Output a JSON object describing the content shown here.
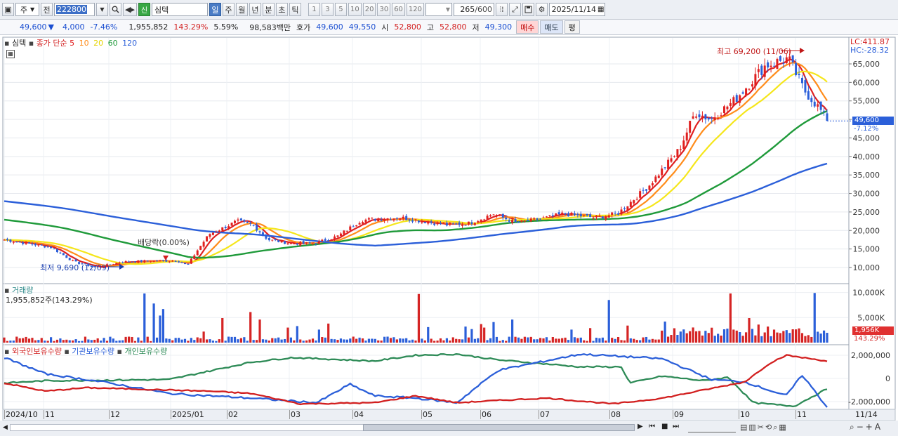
{
  "toolbar": {
    "period_label": "주",
    "prev_label": "전",
    "stock_code": "222800",
    "badge": "신",
    "stock_name": "심텍",
    "tabs": [
      "일",
      "주",
      "월",
      "년",
      "분",
      "초",
      "틱"
    ],
    "active_tab": "일",
    "intervals": [
      "1",
      "3",
      "5",
      "10",
      "20",
      "30",
      "60",
      "120"
    ],
    "count_value": "265",
    "count_max": "/600",
    "date_value": "2025/11/14"
  },
  "quote": {
    "price": "49,600",
    "direction": "▼",
    "change": "4,000",
    "change_rate": "-7.46%",
    "volume": "1,955,852",
    "volume_rate": "143.29%",
    "turnover_rate": "5.59%",
    "trade_value": "98,583백만",
    "ask_label": "호가",
    "ask1": "49,600",
    "ask2": "49,550",
    "open_label": "시",
    "open": "52,800",
    "high_label": "고",
    "high": "52,800",
    "low_label": "저",
    "low": "49,300",
    "buy_label": "매수",
    "sell_label": "매도",
    "flat_label": "평"
  },
  "price_panel": {
    "name": "심텍",
    "ma_label": "종가 단순",
    "ma_periods": [
      "5",
      "10",
      "20",
      "60",
      "120"
    ],
    "ma_colors": [
      "#e02020",
      "#ff8c1a",
      "#f5e61a",
      "#1f9a3a",
      "#2b5fd9"
    ],
    "lc_label": "LC:411.87",
    "hc_label": "HC:-28.32",
    "high_marker": "최고 69,200 (11/06)",
    "low_marker": "최저 9,690 (12/09)",
    "dividend_marker": "배당락(0.00%)",
    "current_price": "49,600",
    "current_rate": "-7.12%",
    "y_ticks": [
      "65,000",
      "60,000",
      "55,000",
      "50,000",
      "45,000",
      "40,000",
      "35,000",
      "30,000",
      "25,000",
      "20,000",
      "15,000",
      "10,000"
    ]
  },
  "volume_panel": {
    "title": "거래량",
    "info": "1,955,852주(143.29%)",
    "y_ticks": [
      "10,000K",
      "5,000K"
    ],
    "current": "1,956K",
    "current_rate": "143.29%"
  },
  "holder_panel": {
    "series": [
      "외국인보유수량",
      "기관보유수량",
      "개인보유수량"
    ],
    "colors": [
      "#d21f1f",
      "#2b5fd9",
      "#2e8b57"
    ],
    "y_ticks": [
      "2,000,000",
      "0",
      "-2,000,000"
    ]
  },
  "x_axis": {
    "labels": [
      "2024/10",
      "11",
      "12",
      "2025/01",
      "02",
      "03",
      "04",
      "05",
      "06",
      "07",
      "08",
      "09",
      "10",
      "11"
    ],
    "right_label": "11/14"
  }
}
